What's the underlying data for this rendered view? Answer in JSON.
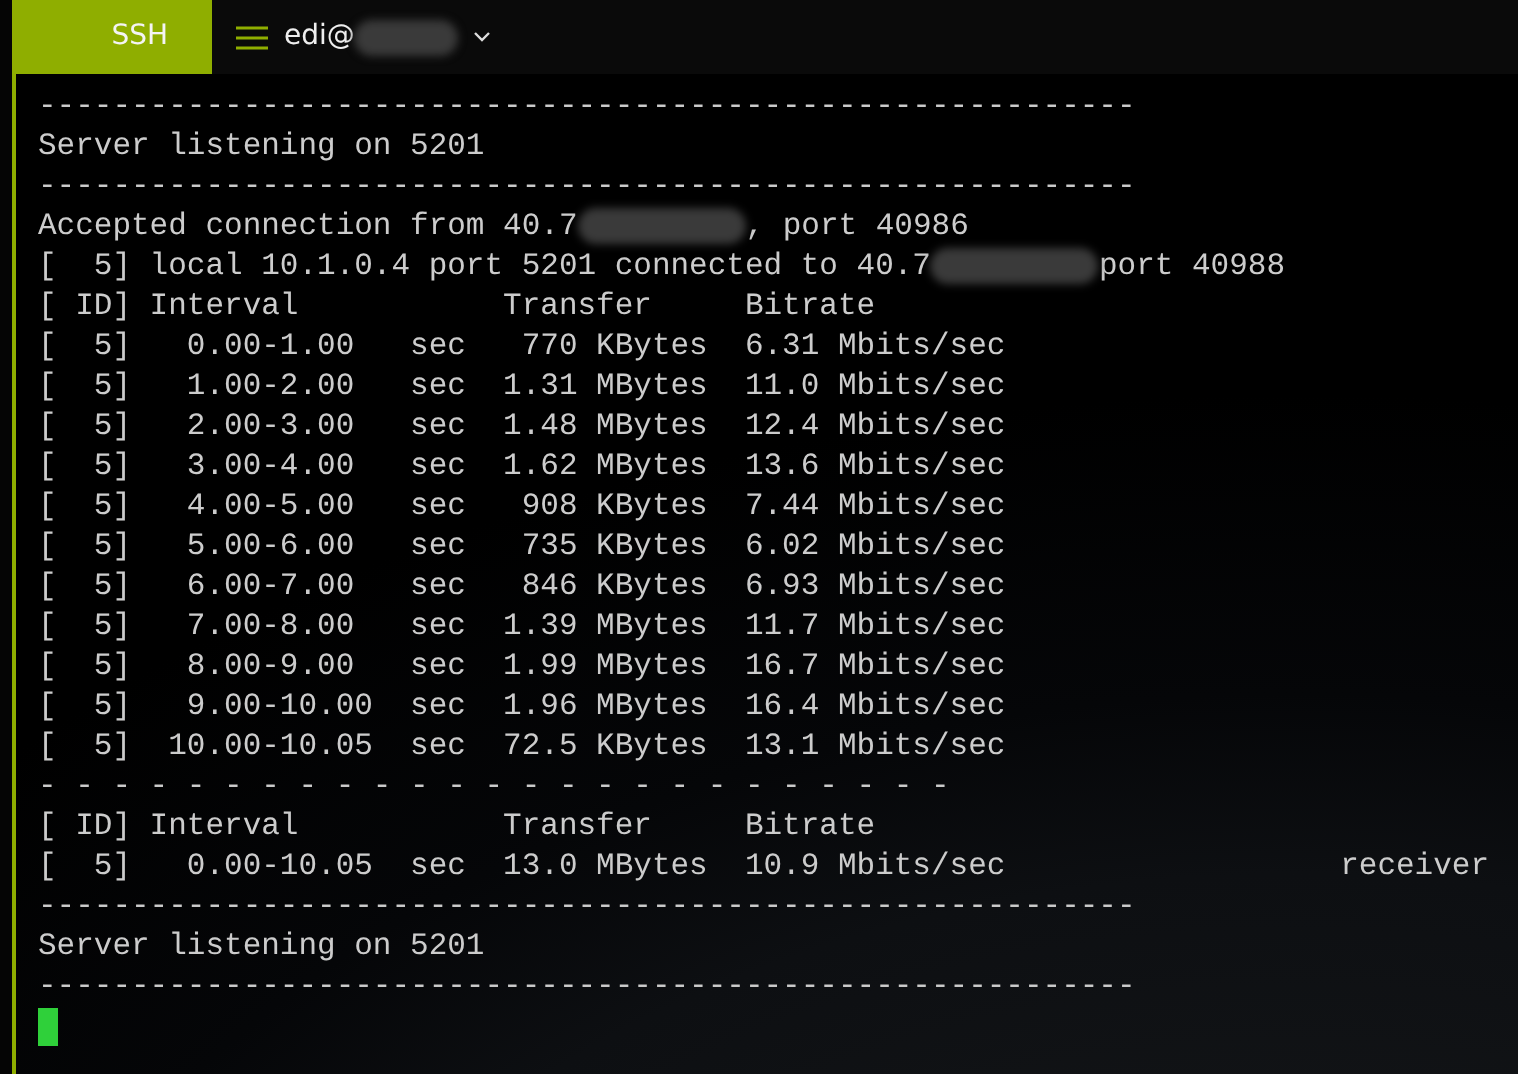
{
  "title_bar": {
    "profile_tab": {
      "label": "SSH",
      "selected": true
    },
    "session_tab": {
      "label": "edi@",
      "redacted": true
    }
  },
  "terminal": {
    "lines": [
      {
        "kind": "rule",
        "text": "-----------------------------------------------------------"
      },
      {
        "kind": "text",
        "text": "Server listening on 5201"
      },
      {
        "kind": "rule",
        "text": "-----------------------------------------------------------"
      },
      {
        "kind": "redacted",
        "parts": [
          "Accepted connection from 40.7",
          ", port 40986"
        ]
      },
      {
        "kind": "redacted",
        "parts": [
          "[  5] local 10.1.0.4 port 5201 connected to 40.7",
          "port 40988"
        ]
      },
      {
        "kind": "text",
        "text": "[ ID] Interval           Transfer     Bitrate"
      },
      {
        "kind": "text",
        "text": "[  5]   0.00-1.00   sec   770 KBytes  6.31 Mbits/sec"
      },
      {
        "kind": "text",
        "text": "[  5]   1.00-2.00   sec  1.31 MBytes  11.0 Mbits/sec"
      },
      {
        "kind": "text",
        "text": "[  5]   2.00-3.00   sec  1.48 MBytes  12.4 Mbits/sec"
      },
      {
        "kind": "text",
        "text": "[  5]   3.00-4.00   sec  1.62 MBytes  13.6 Mbits/sec"
      },
      {
        "kind": "text",
        "text": "[  5]   4.00-5.00   sec   908 KBytes  7.44 Mbits/sec"
      },
      {
        "kind": "text",
        "text": "[  5]   5.00-6.00   sec   735 KBytes  6.02 Mbits/sec"
      },
      {
        "kind": "text",
        "text": "[  5]   6.00-7.00   sec   846 KBytes  6.93 Mbits/sec"
      },
      {
        "kind": "text",
        "text": "[  5]   7.00-8.00   sec  1.39 MBytes  11.7 Mbits/sec"
      },
      {
        "kind": "text",
        "text": "[  5]   8.00-9.00   sec  1.99 MBytes  16.7 Mbits/sec"
      },
      {
        "kind": "text",
        "text": "[  5]   9.00-10.00  sec  1.96 MBytes  16.4 Mbits/sec"
      },
      {
        "kind": "text",
        "text": "[  5]  10.00-10.05  sec  72.5 KBytes  13.1 Mbits/sec"
      },
      {
        "kind": "rule",
        "text": "- - - - - - - - - - - - - - - - - - - - - - - - -"
      },
      {
        "kind": "text",
        "text": "[ ID] Interval           Transfer     Bitrate"
      },
      {
        "kind": "text",
        "text": "[  5]   0.00-10.05  sec  13.0 MBytes  10.9 Mbits/sec                  receiver"
      },
      {
        "kind": "rule",
        "text": "-----------------------------------------------------------"
      },
      {
        "kind": "text",
        "text": "Server listening on 5201"
      },
      {
        "kind": "rule",
        "text": "-----------------------------------------------------------"
      },
      {
        "kind": "cursor"
      }
    ]
  }
}
